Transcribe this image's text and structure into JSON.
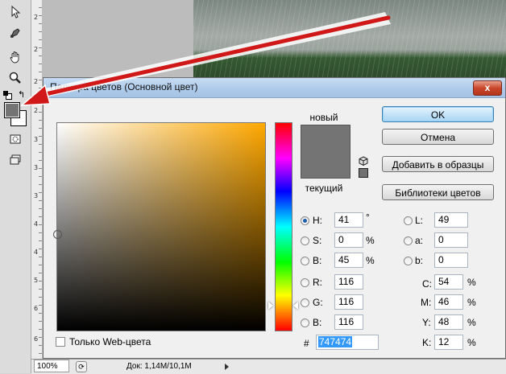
{
  "toolbar": {
    "tools": [
      "move-tool",
      "healing-tool",
      "hand-tool",
      "zoom-tool"
    ],
    "foreground_color": "#747474",
    "background_color": "#ffffff"
  },
  "ruler": {
    "numbers": [
      "2",
      "2",
      "2",
      "2",
      "3",
      "3",
      "3",
      "4",
      "4",
      "5",
      "6",
      "6"
    ]
  },
  "status": {
    "zoom": "100%",
    "doc": "Док: 1,14M/10,1M"
  },
  "dialog": {
    "title": "Палитра цветов (Основной цвет)",
    "close": "x",
    "new_label": "новый",
    "current_label": "текущий",
    "new_color": "#747474",
    "current_color": "#747474",
    "buttons": {
      "ok": "OK",
      "cancel": "Отмена",
      "add_swatches": "Добавить в образцы",
      "libraries": "Библиотеки цветов"
    },
    "fields": {
      "H": {
        "label": "H:",
        "value": "41",
        "unit": "°",
        "selected": true
      },
      "S": {
        "label": "S:",
        "value": "0",
        "unit": "%"
      },
      "B": {
        "label": "B:",
        "value": "45",
        "unit": "%"
      },
      "R": {
        "label": "R:",
        "value": "116"
      },
      "G": {
        "label": "G:",
        "value": "116"
      },
      "Bl": {
        "label": "B:",
        "value": "116"
      },
      "L": {
        "label": "L:",
        "value": "49"
      },
      "a": {
        "label": "a:",
        "value": "0"
      },
      "b": {
        "label": "b:",
        "value": "0"
      },
      "C": {
        "label": "C:",
        "value": "54",
        "unit": "%"
      },
      "M": {
        "label": "M:",
        "value": "46",
        "unit": "%"
      },
      "Y": {
        "label": "Y:",
        "value": "48",
        "unit": "%"
      },
      "K": {
        "label": "K:",
        "value": "12",
        "unit": "%"
      }
    },
    "hex_label": "#",
    "hex_value": "747474",
    "web_only_label": "Только Web-цвета",
    "accent_color": "#d01818"
  }
}
